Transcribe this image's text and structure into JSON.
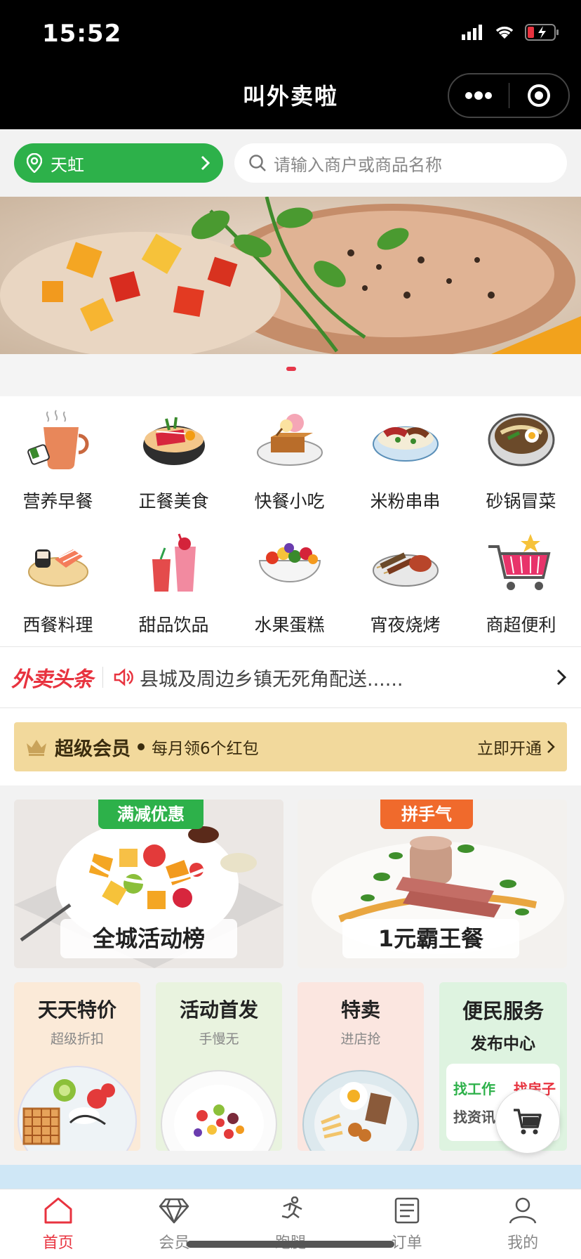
{
  "status_bar": {
    "time": "15:52"
  },
  "nav": {
    "title": "叫外卖啦"
  },
  "location": {
    "label": "天虹"
  },
  "search": {
    "placeholder": "请输入商户或商品名称"
  },
  "categories": [
    {
      "label": "营养早餐",
      "icon": "coffee-breakfast-icon"
    },
    {
      "label": "正餐美食",
      "icon": "bowl-meal-icon"
    },
    {
      "label": "快餐小吃",
      "icon": "snack-plate-icon"
    },
    {
      "label": "米粉串串",
      "icon": "rice-noodle-icon"
    },
    {
      "label": "砂锅冒菜",
      "icon": "clay-pot-icon"
    },
    {
      "label": "西餐料理",
      "icon": "sushi-icon"
    },
    {
      "label": "甜品饮品",
      "icon": "drinks-icon"
    },
    {
      "label": "水果蛋糕",
      "icon": "fruit-bowl-icon"
    },
    {
      "label": "宵夜烧烤",
      "icon": "bbq-icon"
    },
    {
      "label": "商超便利",
      "icon": "shopping-cart-icon"
    }
  ],
  "headline": {
    "brand": "外卖头条",
    "message": "县城及周边乡镇无死角配送......"
  },
  "member": {
    "title": "超级会员",
    "desc": "每月领6个红包",
    "action": "立即开通"
  },
  "promos": [
    {
      "tag": "满减优惠",
      "caption": "全城活动榜"
    },
    {
      "tag": "拼手气",
      "caption": "1元霸王餐"
    }
  ],
  "tiles": [
    {
      "title": "天天特价",
      "sub": "超级折扣"
    },
    {
      "title": "活动首发",
      "sub": "手慢无"
    },
    {
      "title": "特卖",
      "sub": "进店抢"
    },
    {
      "title": "便民服务",
      "sub": "发布中心",
      "links": [
        "找工作",
        "找房子",
        "找资讯"
      ]
    }
  ],
  "tabbar": [
    {
      "label": "首页",
      "icon": "home-icon",
      "active": true
    },
    {
      "label": "会员",
      "icon": "diamond-icon"
    },
    {
      "label": "跑腿",
      "icon": "runner-icon"
    },
    {
      "label": "订单",
      "icon": "order-list-icon"
    },
    {
      "label": "我的",
      "icon": "profile-icon"
    }
  ],
  "colors": {
    "brand_green": "#2db14a",
    "accent_red": "#e8333f",
    "member_gold": "#f2d99c"
  }
}
